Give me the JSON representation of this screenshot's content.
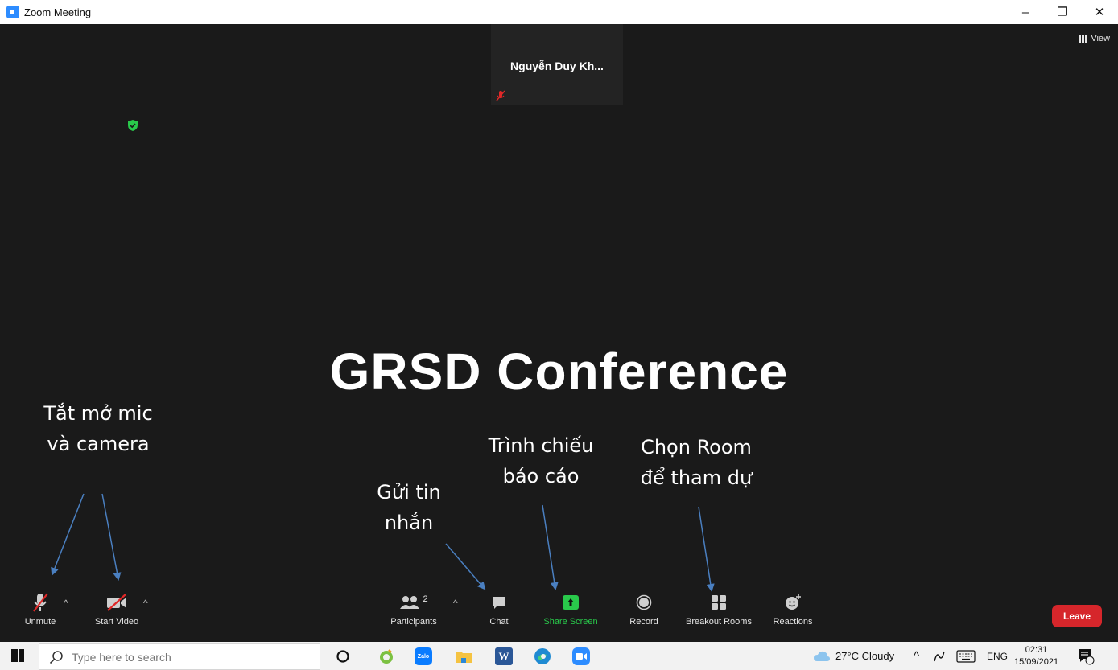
{
  "window": {
    "title": "Zoom Meeting",
    "controls": {
      "minimize": "–",
      "restore": "❐",
      "close": "✕"
    }
  },
  "meeting": {
    "view_label": "View",
    "participant_name": "Nguyễn Duy Kh...",
    "shared_content_title": "GRSD Conference",
    "annotations": {
      "mic_camera_line1": "Tắt mở mic",
      "mic_camera_line2": "và camera",
      "chat_line1": "Gửi tin",
      "chat_line2": "nhắn",
      "share_line1": "Trình chiếu",
      "share_line2": "báo cáo",
      "rooms_line1": "Chọn Room",
      "rooms_line2": "để tham dự"
    }
  },
  "toolbar": {
    "unmute": "Unmute",
    "start_video": "Start Video",
    "participants": "Participants",
    "participants_count": "2",
    "chat": "Chat",
    "share_screen": "Share Screen",
    "record": "Record",
    "breakout_rooms": "Breakout Rooms",
    "reactions": "Reactions",
    "leave": "Leave"
  },
  "colors": {
    "meeting_bg": "#1a1a1a",
    "share_green": "#29c94b",
    "leave_red": "#d6262b",
    "muted_red": "#e02828",
    "annotation_arrow": "#4a7fc0"
  },
  "taskbar": {
    "search_placeholder": "Type here to search",
    "apps": [
      "cortana-icon",
      "greenshot-icon",
      "zalo-icon",
      "file-explorer-icon",
      "word-icon",
      "edge-icon",
      "zoom-icon"
    ],
    "zalo_label": "Zalo",
    "word_label": "W",
    "weather": "27°C  Cloudy",
    "language": "ENG",
    "time": "02:31",
    "date": "15/09/2021",
    "notifications": "7"
  }
}
